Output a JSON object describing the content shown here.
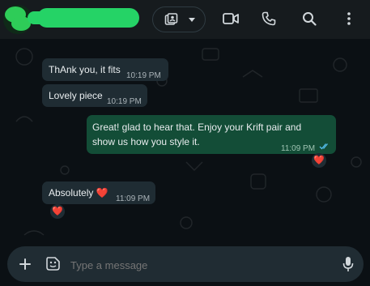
{
  "chat": {
    "contact_name": "",
    "header_icons": [
      "video-call-menu-icon",
      "dropdown-caret-icon",
      "video-icon",
      "phone-icon",
      "search-icon",
      "more-options-icon"
    ]
  },
  "messages": [
    {
      "direction": "incoming",
      "text": "ThAnk you, it fits",
      "time": "10:19 PM"
    },
    {
      "direction": "incoming",
      "text": "Lovely piece",
      "time": "10:19 PM"
    },
    {
      "direction": "outgoing",
      "text_line1": "Great! glad to hear that. Enjoy your Krift pair and",
      "text_line2": "show us how you style it.",
      "time": "11:09 PM",
      "status": "read",
      "reaction": "❤️"
    },
    {
      "direction": "incoming",
      "text": "Absolutely ❤️",
      "time": "11:09 PM",
      "reaction": "❤️"
    }
  ],
  "composer": {
    "placeholder": "Type a message"
  },
  "colors": {
    "app_bg": "#0b1014",
    "header_bg": "#161b1e",
    "incoming_bubble": "#1f2c33",
    "outgoing_bubble": "#134d37",
    "accent": "#25d366",
    "read_tick": "#53bdeb"
  }
}
